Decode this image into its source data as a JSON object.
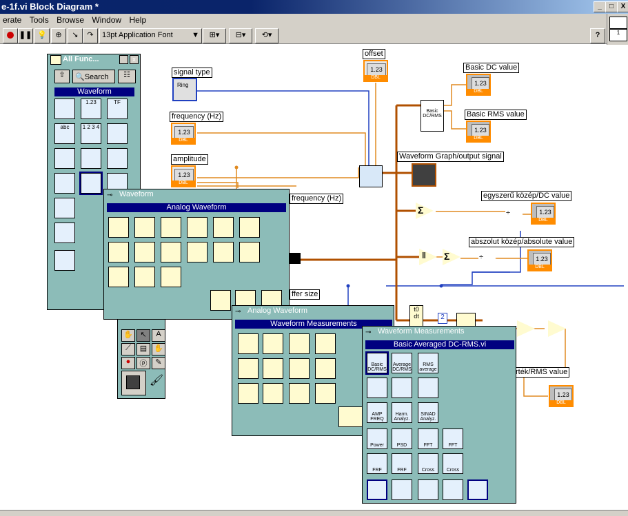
{
  "window": {
    "title": "e-1f.vi Block Diagram *",
    "min": "_",
    "max": "□",
    "close": "X"
  },
  "menu": [
    "erate",
    "Tools",
    "Browse",
    "Window",
    "Help"
  ],
  "toolbar": {
    "font": "13pt Application Font",
    "help": "?"
  },
  "right_icon_label": "1",
  "functions_palette": {
    "title": "All Func...",
    "search": "Search",
    "header": "Waveform"
  },
  "analog_palette": {
    "title": "Waveform",
    "header": "Analog Waveform"
  },
  "measure_palette": {
    "title": "Analog Waveform",
    "header": "Waveform Measurements"
  },
  "dcrms_palette": {
    "title": "Waveform Measurements",
    "header": "Basic Averaged DC-RMS.vi",
    "items": [
      "Basic DC/RMS",
      "Average DC/RMS",
      "RMS average",
      "",
      "",
      "",
      "AMP FREQ",
      "Harm. Analyz.",
      "SINAD Analyz.",
      "Power",
      "PSD",
      "FFT",
      "FFT",
      "FRF",
      "FRF",
      "Cross",
      "Cross",
      "",
      "",
      "",
      "",
      ""
    ]
  },
  "diagram": {
    "labels": {
      "signal_type": "signal type",
      "frequency": "frequency (Hz)",
      "amplitude": "amplitude",
      "offset": "offset",
      "basic_dc": "Basic DC value",
      "basic_rms": "Basic RMS value",
      "graph": "Waveform Graph/output signal",
      "simple_mean": "egyszerű közép/DC value",
      "abs_mean": "abszolut közép/absolute value",
      "sampling_freq": "frequency (Hz)",
      "buffer_size": "ffer size",
      "rms_value": "rték/RMS value"
    },
    "num": "1.23",
    "dtype": "DBL",
    "ring": "Ring",
    "basic_node": "Basic DC/RMS",
    "t0": "t0",
    "dt": "dt",
    "two": "2"
  }
}
